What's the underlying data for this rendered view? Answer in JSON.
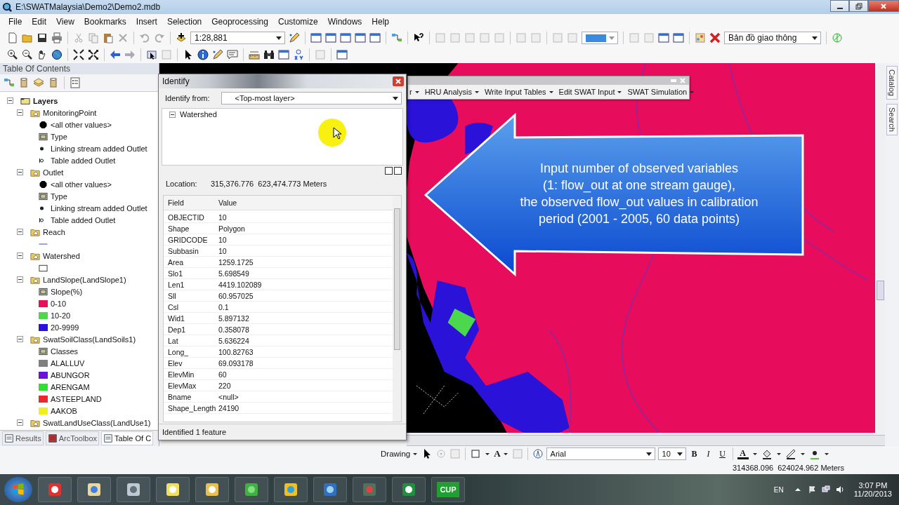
{
  "window": {
    "title": "E:\\SWATMalaysia\\Demo2\\Demo2.mdb"
  },
  "menu": [
    "File",
    "Edit",
    "View",
    "Bookmarks",
    "Insert",
    "Selection",
    "Geoprocessing",
    "Customize",
    "Windows",
    "Help"
  ],
  "toolbar": {
    "scale": "1:28,881",
    "map_layer": "Bản đồ giao thông"
  },
  "toc": {
    "title": "Table Of Contents",
    "tree": [
      {
        "label": "Layers",
        "expanded": true,
        "children": [
          {
            "label": "MonitoringPoint",
            "expanded": true,
            "children": [
              {
                "label": "<all other values>",
                "kind": "marker"
              },
              {
                "label": "Type",
                "kind": "field"
              },
              {
                "label": "Linking stream added Outlet",
                "kind": "point"
              },
              {
                "label": "Table added Outlet",
                "kind": "hollow-point"
              }
            ]
          },
          {
            "label": "Outlet",
            "expanded": true,
            "children": [
              {
                "label": "<all other values>",
                "kind": "marker"
              },
              {
                "label": "Type",
                "kind": "field"
              },
              {
                "label": "Linking stream added Outlet",
                "kind": "point"
              },
              {
                "label": "Table added Outlet",
                "kind": "hollow-point"
              }
            ]
          },
          {
            "label": "Reach",
            "expanded": true,
            "children": [
              {
                "kind": "line"
              }
            ]
          },
          {
            "label": "Watershed",
            "expanded": true,
            "children": [
              {
                "kind": "outline"
              }
            ]
          },
          {
            "label": "LandSlope(LandSlope1)",
            "expanded": true,
            "children": [
              {
                "label": "Slope(%)",
                "kind": "field"
              },
              {
                "label": "0-10",
                "kind": "fill",
                "color": "#e8105a"
              },
              {
                "label": "10-20",
                "kind": "fill",
                "color": "#4cd84c"
              },
              {
                "label": "20-9999",
                "kind": "fill",
                "color": "#2a12d8"
              }
            ]
          },
          {
            "label": "SwatSoilClass(LandSoils1)",
            "expanded": true,
            "children": [
              {
                "label": "Classes",
                "kind": "field"
              },
              {
                "label": "ALALLUV",
                "kind": "fill",
                "color": "#808080"
              },
              {
                "label": "ABUNGOR",
                "kind": "fill",
                "color": "#6a14d8"
              },
              {
                "label": "ARENGAM",
                "kind": "fill",
                "color": "#30e030"
              },
              {
                "label": "ASTEEPLAND",
                "kind": "fill",
                "color": "#e82a2a"
              },
              {
                "label": "AAKOB",
                "kind": "fill",
                "color": "#f0f020"
              }
            ]
          },
          {
            "label": "SwatLandUseClass(LandUse1)",
            "expanded": true
          }
        ]
      }
    ]
  },
  "bottom_tabs": [
    {
      "label": "Results",
      "selected": false
    },
    {
      "label": "ArcToolbox",
      "selected": false
    },
    {
      "label": "Table Of C",
      "selected": true
    }
  ],
  "identify": {
    "title": "Identify",
    "from_label": "Identify from:",
    "from_value": "<Top-most layer>",
    "tree": [
      {
        "label": "Watershed",
        "expanded": true
      }
    ],
    "location_label": "Location:",
    "location_value": "315,376.776  623,474.773 Meters",
    "columns": [
      "Field",
      "Value"
    ],
    "rows": [
      [
        "OBJECTID",
        "10"
      ],
      [
        "Shape",
        "Polygon"
      ],
      [
        "GRIDCODE",
        "10"
      ],
      [
        "Subbasin",
        "10"
      ],
      [
        "Area",
        "1259.1725"
      ],
      [
        "Slo1",
        "5.698549"
      ],
      [
        "Len1",
        "4419.102089"
      ],
      [
        "Sll",
        "60.957025"
      ],
      [
        "Csl",
        "0.1"
      ],
      [
        "Wid1",
        "5.897132"
      ],
      [
        "Dep1",
        "0.358078"
      ],
      [
        "Lat",
        "5.636224"
      ],
      [
        "Long_",
        "100.82763"
      ],
      [
        "Elev",
        "69.093178"
      ],
      [
        "ElevMin",
        "60"
      ],
      [
        "ElevMax",
        "220"
      ],
      [
        "Bname",
        "<null>"
      ],
      [
        "Shape_Length",
        "24190"
      ]
    ],
    "status": "Identified 1 feature"
  },
  "swat_toolbar": [
    "r",
    "HRU Analysis",
    "Write Input Tables",
    "Edit SWAT Input",
    "SWAT Simulation"
  ],
  "callout": [
    "Input number of observed variables",
    "(1: flow_out at one stream gauge),",
    "the observed flow_out values in calibration",
    "period (2001 - 2005, 60 data points)"
  ],
  "dock_tabs": [
    "Catalog",
    "Search"
  ],
  "drawing_toolbar": {
    "label": "Drawing",
    "text_tool": "A",
    "font": "Arial",
    "size": "10",
    "styles": [
      "B",
      "I",
      "U"
    ],
    "font_color": "A"
  },
  "status": "314368.096  624024.962 Meters",
  "taskbar": {
    "pinned_label": "CUP",
    "language": "EN",
    "time": "3:07 PM",
    "date": "11/20/2013"
  }
}
